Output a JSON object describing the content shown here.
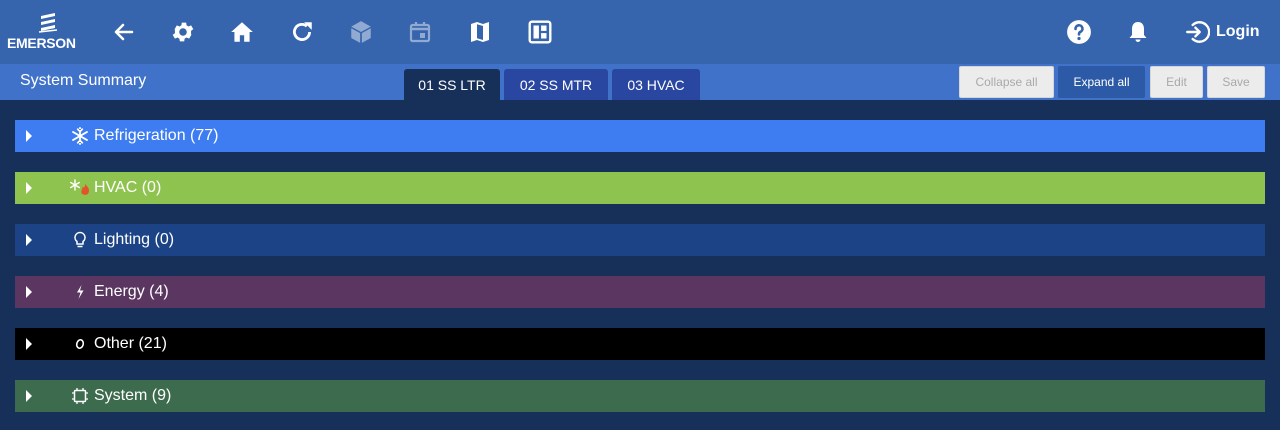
{
  "brand": {
    "name": "EMERSON"
  },
  "toolbar": {
    "icons": [
      "back-arrow-icon",
      "gear-icon",
      "home-icon",
      "refresh-icon",
      "cube-icon",
      "calendar-icon",
      "map-icon",
      "dashboard-icon"
    ],
    "right_icons": [
      "help-icon",
      "bell-icon",
      "login-icon"
    ],
    "login_label": "Login"
  },
  "subbar": {
    "title": "System Summary",
    "tabs": [
      {
        "label": "01 SS LTR",
        "active": true
      },
      {
        "label": "02 SS MTR",
        "active": false
      },
      {
        "label": "03 HVAC",
        "active": false
      }
    ],
    "buttons": {
      "collapse_all": "Collapse all",
      "expand_all": "Expand all",
      "edit": "Edit",
      "save": "Save"
    }
  },
  "groups": [
    {
      "label": "Refrigeration (77)",
      "icon": "snowflake-icon",
      "color": "#3e7cf1"
    },
    {
      "label": "HVAC (0)",
      "icon": "snowflake-flame-icon",
      "color": "#8fc34f"
    },
    {
      "label": "Lighting (0)",
      "icon": "lightbulb-icon",
      "color": "#1b4385"
    },
    {
      "label": "Energy (4)",
      "icon": "plug-icon",
      "color": "#5a3661"
    },
    {
      "label": "Other (21)",
      "icon": "circle-icon",
      "color": "#000000"
    },
    {
      "label": "System (9)",
      "icon": "chip-icon",
      "color": "#3c6b4e"
    }
  ],
  "colors": {
    "topbar": "#3665ad",
    "subbar": "#3f72c8",
    "background": "#17305a",
    "tab_inactive": "#2947a0"
  }
}
